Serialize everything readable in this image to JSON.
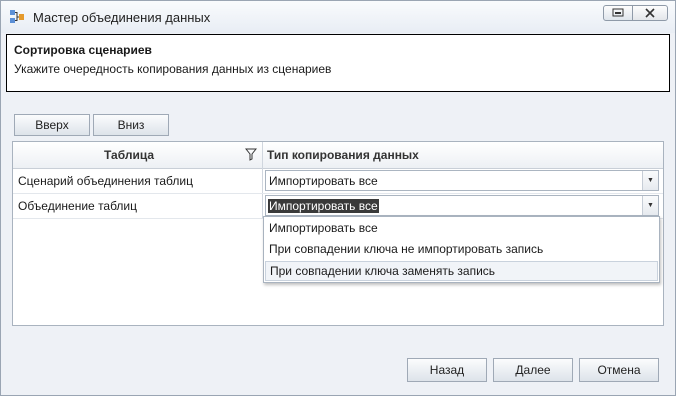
{
  "window": {
    "title": "Мастер объединения данных"
  },
  "header": {
    "title": "Сортировка сценариев",
    "subtitle": "Укажите очередность копирования данных из сценариев"
  },
  "toolbar": {
    "up_label": "Вверх",
    "down_label": "Вниз"
  },
  "grid": {
    "columns": [
      "Таблица",
      "Тип копирования данных"
    ],
    "rows": [
      {
        "name": "Сценарий объединения таблиц",
        "copy_type": "Импортировать все"
      },
      {
        "name": "Объединение таблиц",
        "copy_type": "Импортировать все"
      }
    ]
  },
  "dropdown": {
    "options": [
      "Импортировать все",
      "При совпадении ключа не импортировать запись",
      "При совпадении ключа заменять запись"
    ],
    "highlighted_index": 2
  },
  "footer": {
    "back_label": "Назад",
    "next_label": "Далее",
    "cancel_label": "Отмена"
  }
}
